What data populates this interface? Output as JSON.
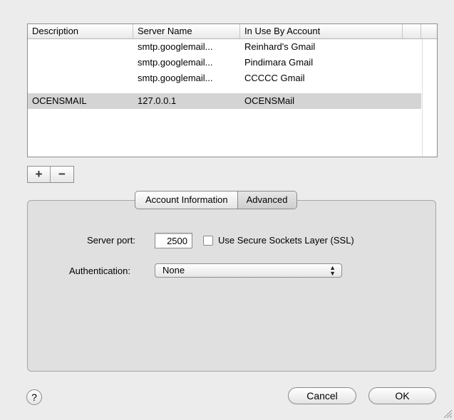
{
  "table": {
    "columns": [
      "Description",
      "Server Name",
      "In Use By Account"
    ],
    "rows": [
      {
        "description": "",
        "server": "smtp.googlemail...",
        "account": "Reinhard's Gmail",
        "selected": false
      },
      {
        "description": "",
        "server": "smtp.googlemail...",
        "account": "Pindimara Gmail",
        "selected": false
      },
      {
        "description": "",
        "server": "smtp.googlemail...",
        "account": "CCCCC Gmail",
        "selected": false
      },
      {
        "description": "OCENSMAIL",
        "server": "127.0.0.1",
        "account": "OCENSMail",
        "selected": true
      }
    ]
  },
  "toolbar": {
    "add_label": "+",
    "remove_label": "−"
  },
  "tabs": [
    {
      "label": "Account Information",
      "active": false
    },
    {
      "label": "Advanced",
      "active": true
    }
  ],
  "advanced": {
    "server_port_label": "Server port:",
    "server_port_value": "2500",
    "ssl_label": "Use Secure Sockets Layer (SSL)",
    "ssl_checked": false,
    "auth_label": "Authentication:",
    "auth_value": "None"
  },
  "footer": {
    "help_label": "?",
    "cancel_label": "Cancel",
    "ok_label": "OK"
  },
  "icons": {
    "help": "help-icon",
    "select_arrows": "updown-arrows-icon",
    "resize": "resize-grip-icon"
  }
}
